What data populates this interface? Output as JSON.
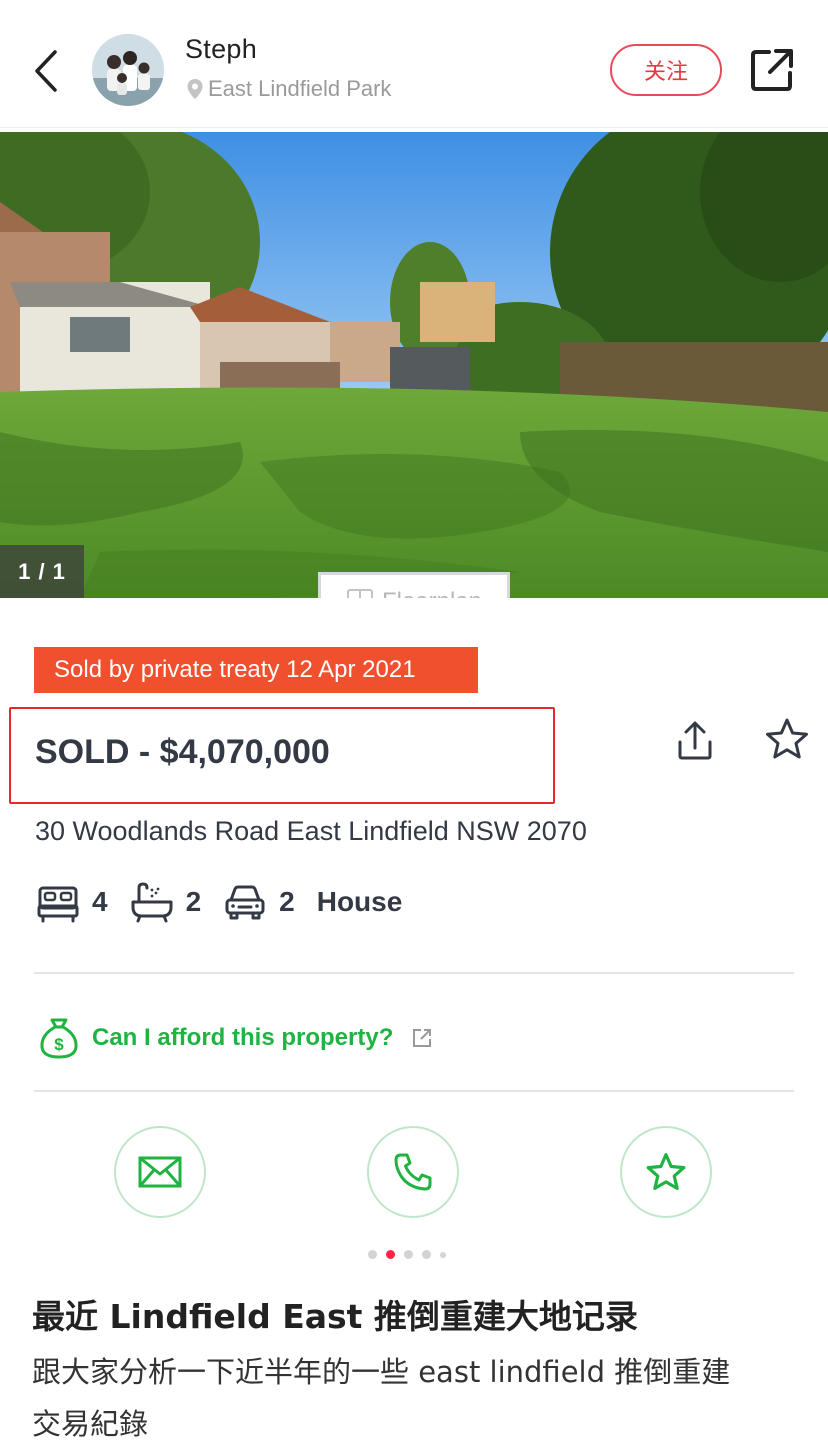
{
  "header": {
    "user_name": "Steph",
    "location": "East Lindfield Park",
    "follow_label": "关注"
  },
  "hero": {
    "photo_counter": "1 / 1",
    "floorplan_label": "Floorplan"
  },
  "listing": {
    "sold_banner": "Sold by private treaty 12 Apr 2021",
    "price": "SOLD - $4,070,000",
    "address": "30 Woodlands Road East Lindfield NSW 2070",
    "features": {
      "bedrooms": "4",
      "bathrooms": "2",
      "parking": "2",
      "property_type": "House"
    },
    "afford_link": "Can I afford this property?"
  },
  "colors": {
    "accent_red": "#ff2442",
    "sold_orange": "#f0502d",
    "afford_green": "#1fb341",
    "price_text": "#333a45"
  },
  "pager": {
    "count": 5,
    "active_index": 1
  },
  "post": {
    "title": "最近 Lindfield East 推倒重建大地记录",
    "body_line1": "跟大家分析一下近半年的一些 east lindfield 推倒重建",
    "body_line2": "交易紀錄"
  }
}
